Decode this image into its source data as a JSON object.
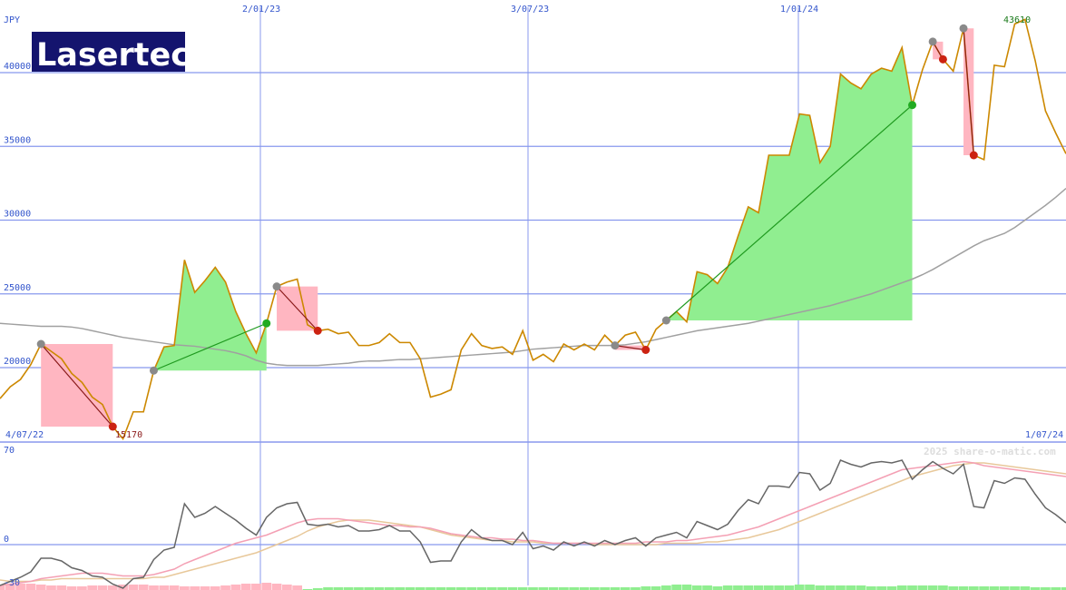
{
  "chart_data": {
    "type": "line",
    "title": "Lasertec",
    "currency": "JPY",
    "colors": {
      "price": "#cc8800",
      "ma": "#a0a0a0",
      "grid": "#8899ee",
      "axis_text": "#3355cc",
      "gain_fill": "#90ee90",
      "loss_fill": "#ffb6c1",
      "ind_main": "#666666",
      "ind_signal1": "#f4a0b4",
      "ind_signal2": "#e8c89a",
      "logo_bg": "#14146e"
    },
    "x_ticks": [
      "4/07/22",
      "2/01/23",
      "3/07/23",
      "1/01/24",
      "1/07/24"
    ],
    "y_ticks": [
      "20000",
      "25000",
      "30000",
      "35000",
      "40000"
    ],
    "ylim": [
      15000,
      44000
    ],
    "annotations": {
      "low": "15170",
      "high": "43610"
    },
    "price": [
      17900,
      18700,
      19200,
      20200,
      21600,
      21100,
      20600,
      19600,
      19000,
      18000,
      17500,
      16000,
      15170,
      17000,
      17000,
      19800,
      21400,
      21500,
      27300,
      25100,
      25900,
      26800,
      25800,
      23800,
      22300,
      21000,
      23000,
      25500,
      25800,
      26000,
      22900,
      22500,
      22600,
      22300,
      22400,
      21500,
      21500,
      21700,
      22300,
      21700,
      21700,
      20600,
      18000,
      18200,
      18500,
      21200,
      22300,
      21500,
      21300,
      21400,
      20900,
      22500,
      20500,
      20900,
      20400,
      21600,
      21200,
      21600,
      21200,
      22200,
      21500,
      22200,
      22400,
      21200,
      22600,
      23200,
      23800,
      23100,
      26500,
      26300,
      25700,
      26800,
      28900,
      30900,
      30500,
      34400,
      34400,
      34400,
      37200,
      37100,
      33900,
      35000,
      39900,
      39300,
      38900,
      39900,
      40300,
      40100,
      41700,
      37800,
      40200,
      42100,
      40900,
      40100,
      43000,
      34400,
      34100,
      40500,
      40400,
      43300,
      43610,
      40800,
      37400,
      35900,
      34500
    ],
    "ma": [
      23000,
      22950,
      22900,
      22850,
      22800,
      22800,
      22800,
      22750,
      22650,
      22500,
      22350,
      22200,
      22050,
      21950,
      21850,
      21750,
      21650,
      21550,
      21500,
      21450,
      21350,
      21250,
      21150,
      21000,
      20800,
      20500,
      20300,
      20200,
      20150,
      20150,
      20150,
      20150,
      20200,
      20250,
      20300,
      20400,
      20450,
      20450,
      20500,
      20550,
      20550,
      20600,
      20650,
      20700,
      20750,
      20800,
      20850,
      20900,
      20950,
      21000,
      21050,
      21150,
      21250,
      21300,
      21350,
      21400,
      21450,
      21500,
      21500,
      21500,
      21500,
      21550,
      21650,
      21750,
      21900,
      22050,
      22200,
      22350,
      22500,
      22600,
      22700,
      22800,
      22900,
      23000,
      23150,
      23300,
      23450,
      23600,
      23750,
      23900,
      24050,
      24200,
      24400,
      24600,
      24800,
      25000,
      25250,
      25500,
      25750,
      26000,
      26300,
      26650,
      27050,
      27450,
      27850,
      28250,
      28600,
      28850,
      29100,
      29500,
      30000,
      30500,
      31000,
      31550,
      32150
    ],
    "trades": [
      {
        "from": 4,
        "to": 11,
        "type": "loss"
      },
      {
        "from": 15,
        "to": 26,
        "type": "gain"
      },
      {
        "from": 27,
        "to": 31,
        "type": "loss"
      },
      {
        "from": 60,
        "to": 63,
        "type": "loss"
      },
      {
        "from": 65,
        "to": 89,
        "type": "gain"
      },
      {
        "from": 91,
        "to": 92,
        "type": "loss"
      },
      {
        "from": 94,
        "to": 95,
        "type": "loss"
      }
    ],
    "indicator": {
      "y_ticks": [
        "70",
        "0",
        "-30"
      ],
      "ylim": [
        -30,
        70
      ],
      "main": [
        -30,
        -27,
        -24,
        -20,
        -10,
        -10,
        -12,
        -17,
        -19,
        -23,
        -24,
        -29,
        -32,
        -25,
        -24,
        -11,
        -4,
        -2,
        30,
        20,
        23,
        28,
        23,
        18,
        12,
        7,
        20,
        27,
        30,
        31,
        15,
        14,
        15,
        13,
        14,
        10,
        10,
        11,
        14,
        10,
        10,
        2,
        -13,
        -12,
        -12,
        2,
        11,
        5,
        3,
        3,
        0,
        9,
        -3,
        -1,
        -4,
        2,
        -1,
        2,
        -1,
        3,
        0,
        3,
        5,
        -1,
        5,
        7,
        9,
        5,
        17,
        14,
        11,
        15,
        25,
        33,
        30,
        43,
        43,
        42,
        53,
        52,
        40,
        45,
        62,
        59,
        57,
        60,
        61,
        60,
        62,
        48,
        55,
        61,
        56,
        52,
        59,
        28,
        27,
        47,
        45,
        49,
        48,
        37,
        27,
        22,
        16
      ],
      "signal1": [
        -30,
        -29,
        -28,
        -27,
        -25,
        -24,
        -23,
        -22,
        -21,
        -21,
        -21,
        -22,
        -23,
        -23,
        -23,
        -22,
        -20,
        -18,
        -14,
        -11,
        -8,
        -5,
        -2,
        1,
        3,
        5,
        7,
        10,
        13,
        16,
        18,
        19,
        19,
        19,
        18,
        17,
        16,
        15,
        14,
        14,
        13,
        13,
        12,
        10,
        8,
        7,
        6,
        5,
        5,
        4,
        4,
        3,
        3,
        2,
        1,
        1,
        1,
        1,
        1,
        1,
        1,
        1,
        1,
        2,
        2,
        2,
        3,
        3,
        4,
        5,
        6,
        7,
        9,
        11,
        13,
        16,
        19,
        22,
        25,
        28,
        31,
        34,
        37,
        40,
        43,
        46,
        49,
        52,
        55,
        56,
        57,
        58,
        59,
        60,
        61,
        60,
        58,
        57,
        56,
        55,
        54,
        53,
        52,
        51,
        50
      ],
      "signal2": [
        -26,
        -27,
        -27,
        -27,
        -26,
        -26,
        -25,
        -25,
        -25,
        -25,
        -25,
        -25,
        -25,
        -25,
        -25,
        -24,
        -24,
        -22,
        -20,
        -18,
        -16,
        -14,
        -12,
        -10,
        -8,
        -6,
        -3,
        0,
        3,
        6,
        10,
        13,
        15,
        17,
        18,
        18,
        18,
        17,
        16,
        15,
        14,
        13,
        11,
        9,
        7,
        6,
        5,
        4,
        3,
        3,
        2,
        2,
        2,
        1,
        1,
        1,
        1,
        1,
        0,
        0,
        0,
        0,
        0,
        0,
        0,
        1,
        1,
        1,
        1,
        2,
        2,
        3,
        4,
        5,
        7,
        9,
        11,
        14,
        17,
        20,
        23,
        26,
        29,
        32,
        35,
        38,
        41,
        44,
        47,
        50,
        52,
        54,
        56,
        58,
        59,
        60,
        60,
        59,
        58,
        57,
        56,
        55,
        54,
        53,
        52
      ],
      "histogram": [
        -6,
        -6,
        -7,
        -7,
        -6,
        -5,
        -5,
        -4,
        -4,
        -5,
        -5,
        -5,
        -6,
        -6,
        -6,
        -5,
        -5,
        -5,
        -4,
        -4,
        -4,
        -4,
        -5,
        -6,
        -7,
        -7,
        -8,
        -7,
        -6,
        -5,
        1,
        2,
        3,
        3,
        3,
        3,
        3,
        3,
        3,
        3,
        3,
        3,
        3,
        3,
        3,
        3,
        3,
        3,
        3,
        3,
        3,
        3,
        3,
        3,
        3,
        3,
        3,
        3,
        3,
        3,
        3,
        3,
        3,
        4,
        4,
        5,
        6,
        6,
        5,
        5,
        4,
        5,
        5,
        5,
        5,
        5,
        5,
        5,
        6,
        6,
        5,
        5,
        5,
        5,
        5,
        4,
        4,
        4,
        5,
        5,
        5,
        5,
        5,
        4,
        4,
        4,
        4,
        4,
        4,
        4,
        4,
        3,
        3,
        3,
        3
      ]
    },
    "watermark": "2025 share-o-matic.com"
  }
}
